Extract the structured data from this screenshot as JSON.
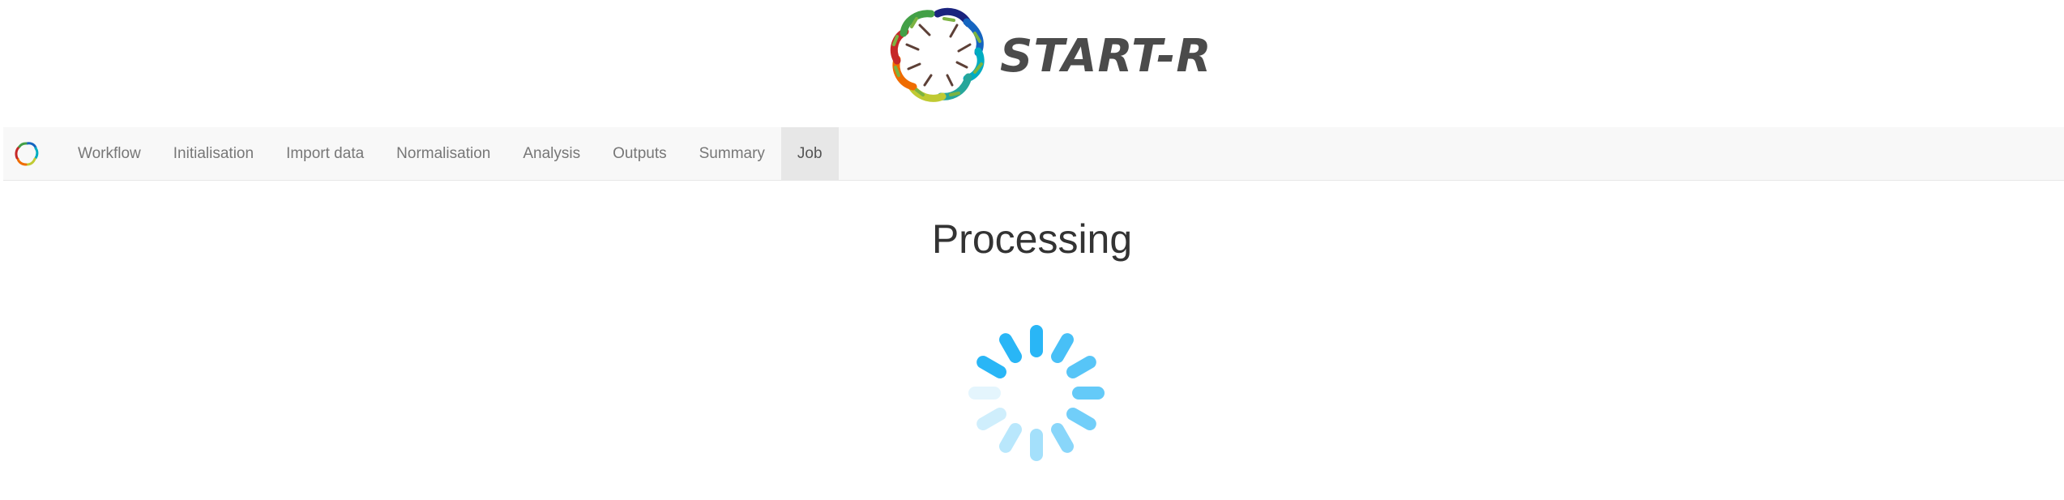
{
  "brand": {
    "title": "START-R",
    "logo_icon": "protein-ring-logo"
  },
  "navbar": {
    "brand_icon": "protein-ring-logo-small",
    "items": [
      {
        "label": "Workflow",
        "active": false
      },
      {
        "label": "Initialisation",
        "active": false
      },
      {
        "label": "Import data",
        "active": false
      },
      {
        "label": "Normalisation",
        "active": false
      },
      {
        "label": "Analysis",
        "active": false
      },
      {
        "label": "Outputs",
        "active": false
      },
      {
        "label": "Summary",
        "active": false
      },
      {
        "label": "Job",
        "active": true
      }
    ]
  },
  "main": {
    "status_title": "Processing",
    "spinner_icon": "loading-spinner-icon",
    "spinner_color": "#29b6f6"
  },
  "colors": {
    "navbar_bg": "#f8f8f8",
    "active_tab_bg": "#e7e7e7",
    "nav_text": "#777777",
    "title_text": "#333333",
    "brand_text": "#4b4b4b"
  }
}
